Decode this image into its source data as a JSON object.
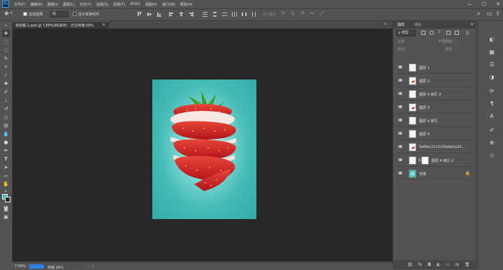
{
  "app": {
    "logo_text": "Ps",
    "menu": [
      "文件(F)",
      "编辑(E)",
      "图像(I)",
      "图层(L)",
      "文字(Y)",
      "选择(S)",
      "滤镜(T)",
      "3D(D)",
      "视图(V)",
      "窗口(W)",
      "帮助(H)"
    ],
    "window_controls": {
      "minimize": "—",
      "maximize": "☐",
      "close": "✕"
    }
  },
  "options": {
    "auto_select_label": "自动选择:",
    "auto_select_value": "组",
    "show_transform_label": "显示变换控件",
    "mode_label": "3D 模式:"
  },
  "document": {
    "tab_label": "未标题-1.psd @ 7.89%(RGB/8) - 正在存储 59%",
    "close": "×"
  },
  "status": {
    "zoom": "7.89%",
    "save_text": "存储 26%",
    "save_progress": 0.26
  },
  "layers_panel": {
    "tabs": [
      "图层",
      "通道"
    ],
    "filter_label": "ρ 类型",
    "blend_mode": "正常",
    "opacity_label": "不透明度:",
    "lock_label": "锁定:",
    "fill_label": "填充:",
    "layers": [
      {
        "name": "图层 1",
        "thumb": "blank",
        "lock": false
      },
      {
        "name": "图层 2",
        "thumb": "red",
        "lock": false
      },
      {
        "name": "图层 4 拷贝 3",
        "thumb": "blank",
        "lock": false
      },
      {
        "name": "图层 3",
        "thumb": "red",
        "lock": false
      },
      {
        "name": "图层 4 拷贝",
        "thumb": "blank",
        "lock": false
      },
      {
        "name": "图层 4",
        "thumb": "blank",
        "lock": false
      },
      {
        "name": "5ef9ec21c3c55ebb1a23...",
        "thumb": "red",
        "lock": false
      },
      {
        "name": "图层 4 拷贝 2",
        "thumb": "mask",
        "lock": false
      },
      {
        "name": "背景",
        "thumb": "teal",
        "lock": true
      }
    ],
    "footer_icons": [
      "link-icon",
      "fx-icon",
      "mask-icon",
      "adjustment-icon",
      "folder-icon",
      "new-layer-icon",
      "trash-icon"
    ]
  },
  "colors": {
    "accent": "#31a8ff",
    "foreground_swatch": "#3fb7b5",
    "background_swatch": "#2a2a2a",
    "artboard_bg": "#3fb7b5",
    "strawberry_red": "#d3221f",
    "leaf_green": "#3f9a2e"
  }
}
